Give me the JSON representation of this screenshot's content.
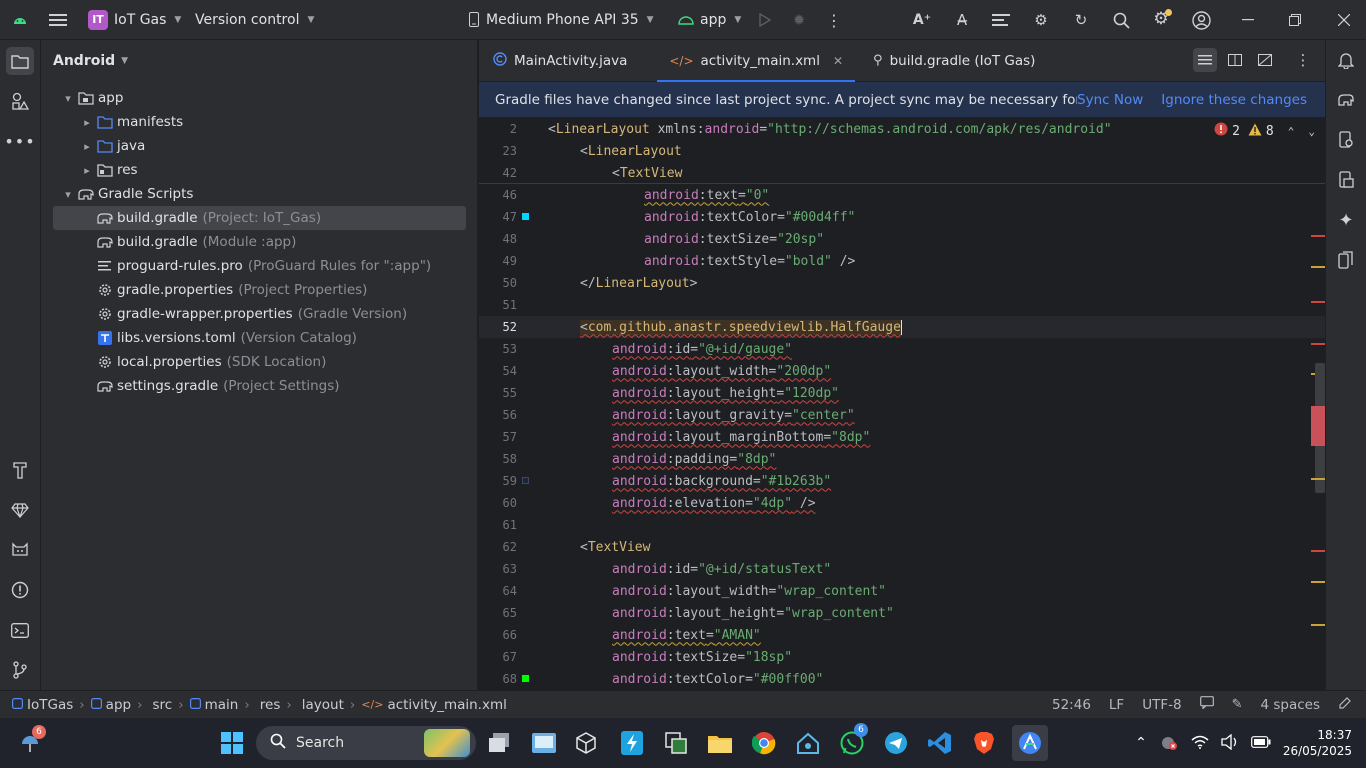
{
  "titlebar": {
    "project_badge": "IT",
    "project_name": "IoT Gas",
    "vcs": "Version control",
    "device": "Medium Phone API 35",
    "run_config": "app"
  },
  "project_panel": {
    "title": "Android",
    "tree": [
      {
        "label": "app",
        "hint": "",
        "indent": 0,
        "arrow": "▾",
        "icon": "module-folder-icon"
      },
      {
        "label": "manifests",
        "hint": "",
        "indent": 1,
        "arrow": "▸",
        "icon": "folder-icon"
      },
      {
        "label": "java",
        "hint": "",
        "indent": 1,
        "arrow": "▸",
        "icon": "folder-icon"
      },
      {
        "label": "res",
        "hint": "",
        "indent": 1,
        "arrow": "▸",
        "icon": "res-folder-icon"
      },
      {
        "label": "Gradle Scripts",
        "hint": "",
        "indent": 0,
        "arrow": "▾",
        "icon": "gradle-icon"
      },
      {
        "label": "build.gradle",
        "hint": "(Project: IoT_Gas)",
        "indent": 1,
        "arrow": "",
        "icon": "gradle-icon",
        "selected": true
      },
      {
        "label": "build.gradle",
        "hint": "(Module :app)",
        "indent": 1,
        "arrow": "",
        "icon": "gradle-icon"
      },
      {
        "label": "proguard-rules.pro",
        "hint": "(ProGuard Rules for \":app\")",
        "indent": 1,
        "arrow": "",
        "icon": "text-file-icon"
      },
      {
        "label": "gradle.properties",
        "hint": "(Project Properties)",
        "indent": 1,
        "arrow": "",
        "icon": "gear-icon"
      },
      {
        "label": "gradle-wrapper.properties",
        "hint": "(Gradle Version)",
        "indent": 1,
        "arrow": "",
        "icon": "gear-icon"
      },
      {
        "label": "libs.versions.toml",
        "hint": "(Version Catalog)",
        "indent": 1,
        "arrow": "",
        "icon": "toml-icon"
      },
      {
        "label": "local.properties",
        "hint": "(SDK Location)",
        "indent": 1,
        "arrow": "",
        "icon": "gear-icon"
      },
      {
        "label": "settings.gradle",
        "hint": "(Project Settings)",
        "indent": 1,
        "arrow": "",
        "icon": "gradle-icon"
      }
    ]
  },
  "tabs": [
    {
      "label": "MainActivity.java",
      "icon": "java-class-icon",
      "active": false
    },
    {
      "label": "activity_main.xml",
      "icon": "xml-icon",
      "active": true
    },
    {
      "label": "build.gradle (IoT Gas)",
      "icon": "gradle-icon",
      "active": false
    }
  ],
  "banner": {
    "message": "Gradle files have changed since last project sync. A project sync may be necessary for the I...",
    "sync_now": "Sync Now",
    "ignore": "Ignore these changes"
  },
  "inspections": {
    "errors": "2",
    "warnings": "8"
  },
  "sticky_lines": [
    {
      "num": "2",
      "indent": 0,
      "tokens": [
        [
          "t-br",
          "<"
        ],
        [
          "t-tag",
          "LinearLayout"
        ],
        [
          "t-attr",
          " xmlns"
        ],
        [
          "t-br",
          ":"
        ],
        [
          "t-ns",
          "android"
        ],
        [
          "t-br",
          "="
        ],
        [
          "t-val",
          "\"http://schemas.android.com/apk/res/android\""
        ]
      ]
    },
    {
      "num": "23",
      "indent": 1,
      "tokens": [
        [
          "t-br",
          "<"
        ],
        [
          "t-tag",
          "LinearLayout"
        ]
      ]
    },
    {
      "num": "42",
      "indent": 2,
      "tokens": [
        [
          "t-br",
          "<"
        ],
        [
          "t-tag",
          "TextView"
        ]
      ]
    }
  ],
  "code_lines": [
    {
      "num": "46",
      "indent": 3,
      "tokens": [
        [
          "t-ns",
          "android"
        ],
        [
          "t-br",
          ":"
        ],
        [
          "t-attr",
          "text"
        ],
        [
          "t-br",
          "="
        ],
        [
          "t-val",
          "\"0\""
        ]
      ],
      "style": "wavy-y"
    },
    {
      "num": "47",
      "indent": 3,
      "tokens": [
        [
          "t-ns",
          "android"
        ],
        [
          "t-br",
          ":"
        ],
        [
          "t-attr",
          "textColor"
        ],
        [
          "t-br",
          "="
        ],
        [
          "t-val",
          "\"#00d4ff\""
        ]
      ],
      "marker": "#00d4ff"
    },
    {
      "num": "48",
      "indent": 3,
      "tokens": [
        [
          "t-ns",
          "android"
        ],
        [
          "t-br",
          ":"
        ],
        [
          "t-attr",
          "textSize"
        ],
        [
          "t-br",
          "="
        ],
        [
          "t-val",
          "\"20sp\""
        ]
      ]
    },
    {
      "num": "49",
      "indent": 3,
      "tokens": [
        [
          "t-ns",
          "android"
        ],
        [
          "t-br",
          ":"
        ],
        [
          "t-attr",
          "textStyle"
        ],
        [
          "t-br",
          "="
        ],
        [
          "t-val",
          "\"bold\""
        ],
        [
          "t-br",
          " />"
        ]
      ]
    },
    {
      "num": "50",
      "indent": 1,
      "tokens": [
        [
          "t-br",
          "</"
        ],
        [
          "t-tag",
          "LinearLayout"
        ],
        [
          "t-br",
          ">"
        ]
      ]
    },
    {
      "num": "51",
      "indent": 0,
      "tokens": []
    },
    {
      "num": "52",
      "indent": 1,
      "tokens": [
        [
          "t-br",
          "<"
        ],
        [
          "t-tag",
          "com.github.anastr.speedviewlib.HalfGauge"
        ]
      ],
      "current": true,
      "style": "wavy"
    },
    {
      "num": "53",
      "indent": 2,
      "tokens": [
        [
          "t-ns",
          "android"
        ],
        [
          "t-br",
          ":"
        ],
        [
          "t-attr",
          "id"
        ],
        [
          "t-br",
          "="
        ],
        [
          "t-val",
          "\"@+id/gauge\""
        ]
      ],
      "style": "wavy"
    },
    {
      "num": "54",
      "indent": 2,
      "tokens": [
        [
          "t-ns",
          "android"
        ],
        [
          "t-br",
          ":"
        ],
        [
          "t-attr",
          "layout_width"
        ],
        [
          "t-br",
          "="
        ],
        [
          "t-val",
          "\"200dp\""
        ]
      ],
      "style": "wavy"
    },
    {
      "num": "55",
      "indent": 2,
      "tokens": [
        [
          "t-ns",
          "android"
        ],
        [
          "t-br",
          ":"
        ],
        [
          "t-attr",
          "layout_height"
        ],
        [
          "t-br",
          "="
        ],
        [
          "t-val",
          "\"120dp\""
        ]
      ],
      "style": "wavy"
    },
    {
      "num": "56",
      "indent": 2,
      "tokens": [
        [
          "t-ns",
          "android"
        ],
        [
          "t-br",
          ":"
        ],
        [
          "t-attr",
          "layout_gravity"
        ],
        [
          "t-br",
          "="
        ],
        [
          "t-val",
          "\"center\""
        ]
      ],
      "style": "wavy"
    },
    {
      "num": "57",
      "indent": 2,
      "tokens": [
        [
          "t-ns",
          "android"
        ],
        [
          "t-br",
          ":"
        ],
        [
          "t-attr",
          "layout_marginBottom"
        ],
        [
          "t-br",
          "="
        ],
        [
          "t-val",
          "\"8dp\""
        ]
      ],
      "style": "wavy"
    },
    {
      "num": "58",
      "indent": 2,
      "tokens": [
        [
          "t-ns",
          "android"
        ],
        [
          "t-br",
          ":"
        ],
        [
          "t-attr",
          "padding"
        ],
        [
          "t-br",
          "="
        ],
        [
          "t-val",
          "\"8dp\""
        ]
      ],
      "style": "wavy"
    },
    {
      "num": "59",
      "indent": 2,
      "tokens": [
        [
          "t-ns",
          "android"
        ],
        [
          "t-br",
          ":"
        ],
        [
          "t-attr",
          "background"
        ],
        [
          "t-br",
          "="
        ],
        [
          "t-val",
          "\"#1b263b\""
        ]
      ],
      "style": "wavy",
      "marker": "#1b263b"
    },
    {
      "num": "60",
      "indent": 2,
      "tokens": [
        [
          "t-ns",
          "android"
        ],
        [
          "t-br",
          ":"
        ],
        [
          "t-attr",
          "elevation"
        ],
        [
          "t-br",
          "="
        ],
        [
          "t-val",
          "\"4dp\""
        ],
        [
          "t-br",
          " />"
        ]
      ],
      "style": "wavy"
    },
    {
      "num": "61",
      "indent": 0,
      "tokens": []
    },
    {
      "num": "62",
      "indent": 1,
      "tokens": [
        [
          "t-br",
          "<"
        ],
        [
          "t-tag",
          "TextView"
        ]
      ]
    },
    {
      "num": "63",
      "indent": 2,
      "tokens": [
        [
          "t-ns",
          "android"
        ],
        [
          "t-br",
          ":"
        ],
        [
          "t-attr",
          "id"
        ],
        [
          "t-br",
          "="
        ],
        [
          "t-val",
          "\"@+id/statusText\""
        ]
      ]
    },
    {
      "num": "64",
      "indent": 2,
      "tokens": [
        [
          "t-ns",
          "android"
        ],
        [
          "t-br",
          ":"
        ],
        [
          "t-attr",
          "layout_width"
        ],
        [
          "t-br",
          "="
        ],
        [
          "t-val",
          "\"wrap_content\""
        ]
      ]
    },
    {
      "num": "65",
      "indent": 2,
      "tokens": [
        [
          "t-ns",
          "android"
        ],
        [
          "t-br",
          ":"
        ],
        [
          "t-attr",
          "layout_height"
        ],
        [
          "t-br",
          "="
        ],
        [
          "t-val",
          "\"wrap_content\""
        ]
      ]
    },
    {
      "num": "66",
      "indent": 2,
      "tokens": [
        [
          "t-ns",
          "android"
        ],
        [
          "t-br",
          ":"
        ],
        [
          "t-attr",
          "text"
        ],
        [
          "t-br",
          "="
        ],
        [
          "t-val",
          "\"AMAN\""
        ]
      ],
      "style": "wavy-y"
    },
    {
      "num": "67",
      "indent": 2,
      "tokens": [
        [
          "t-ns",
          "android"
        ],
        [
          "t-br",
          ":"
        ],
        [
          "t-attr",
          "textSize"
        ],
        [
          "t-br",
          "="
        ],
        [
          "t-val",
          "\"18sp\""
        ]
      ]
    },
    {
      "num": "68",
      "indent": 2,
      "tokens": [
        [
          "t-ns",
          "android"
        ],
        [
          "t-br",
          ":"
        ],
        [
          "t-attr",
          "textColor"
        ],
        [
          "t-br",
          "="
        ],
        [
          "t-val",
          "\"#00ff00\""
        ]
      ],
      "marker": "#00ff00"
    }
  ],
  "statusbar": {
    "crumbs": [
      "IoTGas",
      "app",
      "src",
      "main",
      "res",
      "layout",
      "activity_main.xml"
    ],
    "position": "52:46",
    "line_sep": "LF",
    "encoding": "UTF-8",
    "indent": "4 spaces"
  },
  "taskbar": {
    "search": "Search",
    "weather_badge": "6",
    "whatsapp_badge": "6",
    "time": "18:37",
    "date": "26/05/2025"
  },
  "colors": {
    "accent": "#3574f0",
    "error": "#d0453f",
    "warning": "#c9a33a"
  }
}
